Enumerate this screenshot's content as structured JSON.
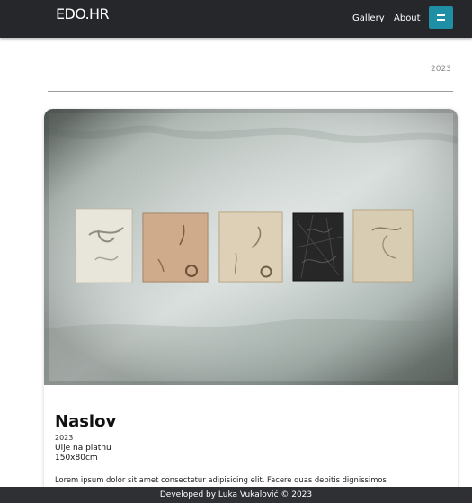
{
  "navbar": {
    "brand_title": "EDO.HR",
    "brand_subtitle": "",
    "links": [
      "Gallery",
      "About"
    ],
    "menu_icon": "hamburger-menu-icon",
    "menu_color": "#1e8fa5"
  },
  "main": {
    "year_heading": "2023",
    "artwork": {
      "image_label": "Five textured wall panels",
      "title": "Naslov",
      "year": "2023",
      "technique": "Ulje na platnu",
      "dimensions": "150x80cm",
      "description": "Lorem ipsum dolor sit amet consectetur adipisicing elit. Facere quas debitis dignissimos"
    }
  },
  "footer": {
    "credit": "Developed by Luka Vukalović © 2023"
  },
  "colors": {
    "navbar_background": "#25272b",
    "footer_background": "#2e3034",
    "accent": "#1e8fa5"
  }
}
